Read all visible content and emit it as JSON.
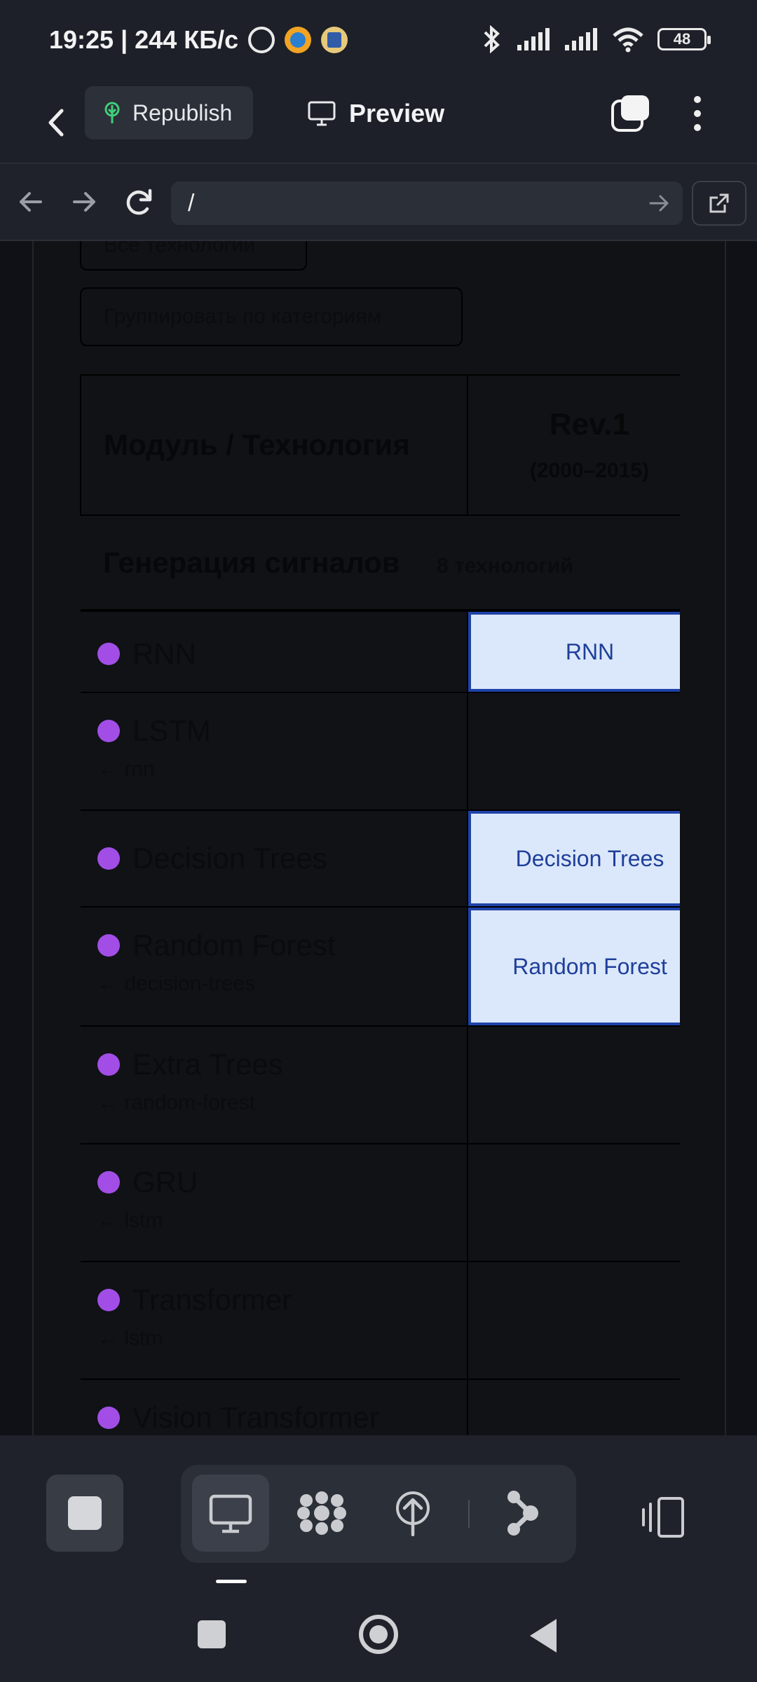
{
  "status_bar": {
    "time_speed": "19:25 | 244 КБ/с",
    "battery": "48",
    "icons": [
      "alarm-icon",
      "telegram-icon",
      "app-icon",
      "bluetooth-icon",
      "signal-icon",
      "signal-icon",
      "wifi-icon",
      "battery-icon"
    ]
  },
  "toolbar": {
    "republish_label": "Republish",
    "preview_label": "Preview"
  },
  "url_bar": {
    "value": "/"
  },
  "page": {
    "all_tech_button": "Все технологии",
    "group_button": "Группировать по категориям",
    "table": {
      "col_module": "Модуль / Технология",
      "col_rev_title": "Rev.1",
      "col_rev_years": "(2000–2015)"
    },
    "category": {
      "title": "Генерация сигналов",
      "count": "8 технологий"
    },
    "rows": [
      {
        "name": "RNN",
        "dep": "",
        "rev": "RNN"
      },
      {
        "name": "LSTM",
        "dep": "← rnn",
        "rev": ""
      },
      {
        "name": "Decision Trees",
        "dep": "",
        "rev": "Decision Trees"
      },
      {
        "name": "Random Forest",
        "dep": "← decision-trees",
        "rev": "Random Forest"
      },
      {
        "name": "Extra Trees",
        "dep": "← random-forest",
        "rev": ""
      },
      {
        "name": "GRU",
        "dep": "← lstm",
        "rev": ""
      },
      {
        "name": "Transformer",
        "dep": "← lstm",
        "rev": ""
      },
      {
        "name": "Vision Transformer",
        "dep": "",
        "rev": ""
      }
    ]
  },
  "colors": {
    "accent_dot": "#a24ee6",
    "highlight_bg": "#dbe8fb",
    "highlight_border": "#1f43a8"
  }
}
